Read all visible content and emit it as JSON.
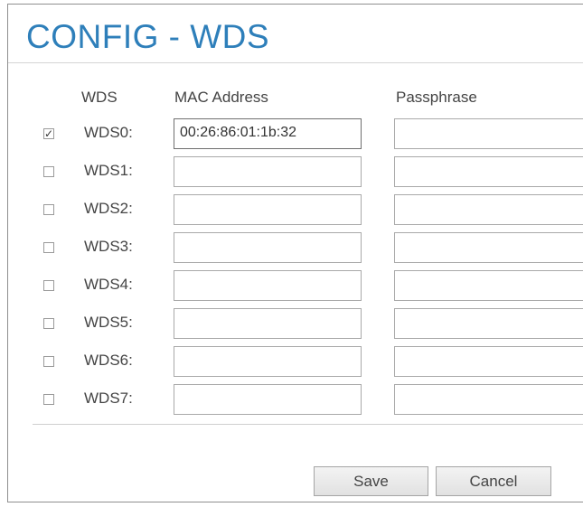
{
  "page": {
    "title": "CONFIG - WDS",
    "accent_color": "#2e7fba"
  },
  "table": {
    "headers": {
      "wds": "WDS",
      "mac": "MAC Address",
      "passphrase": "Passphrase"
    },
    "rows": [
      {
        "label": "WDS0:",
        "checked": true,
        "check_glyph": "✓",
        "mac": "00:26:86:01:1b:32",
        "passphrase": ""
      },
      {
        "label": "WDS1:",
        "checked": false,
        "check_glyph": "",
        "mac": "",
        "passphrase": ""
      },
      {
        "label": "WDS2:",
        "checked": false,
        "check_glyph": "",
        "mac": "",
        "passphrase": ""
      },
      {
        "label": "WDS3:",
        "checked": false,
        "check_glyph": "",
        "mac": "",
        "passphrase": ""
      },
      {
        "label": "WDS4:",
        "checked": false,
        "check_glyph": "",
        "mac": "",
        "passphrase": ""
      },
      {
        "label": "WDS5:",
        "checked": false,
        "check_glyph": "",
        "mac": "",
        "passphrase": ""
      },
      {
        "label": "WDS6:",
        "checked": false,
        "check_glyph": "",
        "mac": "",
        "passphrase": ""
      },
      {
        "label": "WDS7:",
        "checked": false,
        "check_glyph": "",
        "mac": "",
        "passphrase": ""
      }
    ]
  },
  "buttons": {
    "save_label": "Save",
    "cancel_label": "Cancel"
  }
}
